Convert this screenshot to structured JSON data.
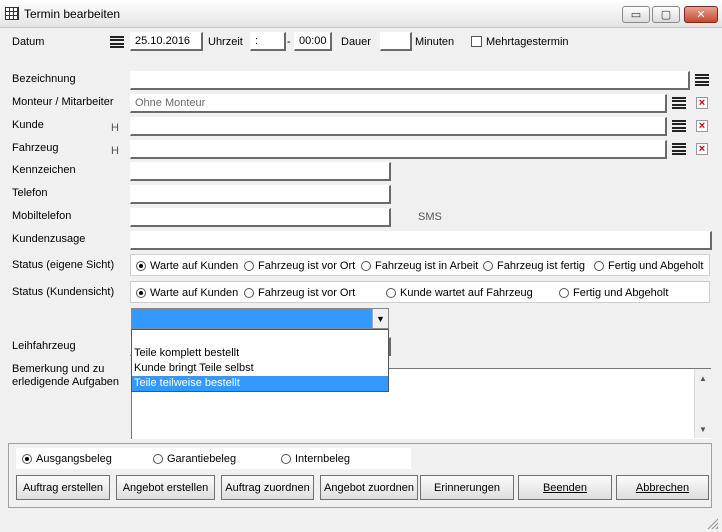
{
  "window": {
    "title": "Termin bearbeiten",
    "buttons": {
      "minimize": "▭",
      "maximize": "▢",
      "close": "✕"
    }
  },
  "top": {
    "datum_label": "Datum",
    "datum_value": "25.10.2016",
    "uhrzeit_label": "Uhrzeit",
    "uhrzeit_value": ":",
    "dash": "-",
    "end_time": "00:00",
    "dauer_label": "Dauer",
    "dauer_value": "",
    "minuten_label": "Minuten",
    "mehrtages_label": "Mehrtagestermin"
  },
  "form": {
    "bezeichnung_label": "Bezeichnung",
    "bezeichnung_value": "",
    "monteur_label": "Monteur / Mitarbeiter",
    "monteur_placeholder": "Ohne Monteur",
    "kunde_label": "Kunde",
    "kunde_hint": "H",
    "kunde_value": "",
    "fahrzeug_label": "Fahrzeug",
    "fahrzeug_hint": "H",
    "fahrzeug_value": "",
    "kennzeichen_label": "Kennzeichen",
    "telefon_label": "Telefon",
    "mobiltelefon_label": "Mobiltelefon",
    "sms_label": "SMS",
    "kundenzusage_label": "Kundenzusage"
  },
  "status_eigen": {
    "label": "Status (eigene Sicht)",
    "options": [
      "Warte auf Kunden",
      "Fahrzeug ist vor Ort",
      "Fahrzeug ist in Arbeit",
      "Fahrzeug ist fertig",
      "Fertig und Abgeholt"
    ],
    "selected": 0
  },
  "status_kunde": {
    "label": "Status (Kundensicht)",
    "options": [
      "Warte auf Kunden",
      "Fahrzeug ist vor Ort",
      "Kunde wartet auf Fahrzeug",
      "Fertig und Abgeholt"
    ],
    "selected": 0
  },
  "dropdown": {
    "selected_value": "",
    "options": [
      "",
      "Teile komplett bestellt",
      "Kunde bringt Teile selbst",
      "Teile teilweise bestellt"
    ],
    "highlighted": 3
  },
  "leihfahrzeug_label": "Leihfahrzeug",
  "bemerkung_label_line1": "Bemerkung und zu",
  "bemerkung_label_line2": "erledigende Aufgaben",
  "bemerkung_value": "",
  "beleg": {
    "options": [
      "Ausgangsbeleg",
      "Garantiebeleg",
      "Internbeleg"
    ],
    "selected": 0
  },
  "buttons": {
    "auftrag_erstellen": "Auftrag erstellen",
    "angebot_erstellen": "Angebot erstellen",
    "auftrag_zuordnen": "Auftrag zuordnen",
    "angebot_zuordnen": "Angebot zuordnen",
    "erinnerungen": "Erinnerungen",
    "beenden": "Beenden",
    "abbrechen": "Abbrechen"
  }
}
